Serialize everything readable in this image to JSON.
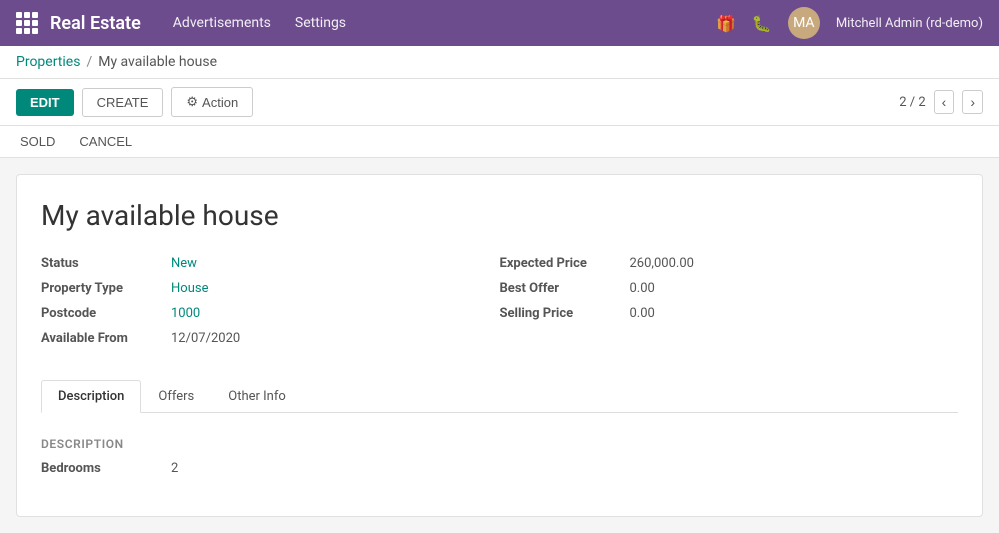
{
  "app": {
    "name": "Real Estate",
    "nav": [
      "Advertisements",
      "Settings"
    ],
    "user": "Mitchell Admin (rd-demo)"
  },
  "breadcrumb": {
    "parent": "Properties",
    "separator": "/",
    "current": "My available house"
  },
  "toolbar": {
    "edit_label": "EDIT",
    "create_label": "CREATE",
    "action_label": "Action",
    "action_icon": "⚙",
    "pagination": "2 / 2"
  },
  "status_buttons": {
    "sold": "SOLD",
    "cancel": "CANCEL"
  },
  "record": {
    "title": "My available house",
    "fields_left": [
      {
        "label": "Status",
        "value": "New",
        "type": "link"
      },
      {
        "label": "Property Type",
        "value": "House",
        "type": "link"
      },
      {
        "label": "Postcode",
        "value": "1000",
        "type": "link"
      },
      {
        "label": "Available From",
        "value": "12/07/2020",
        "type": "plain"
      }
    ],
    "fields_right": [
      {
        "label": "Expected Price",
        "value": "260,000.00",
        "type": "plain"
      },
      {
        "label": "Best Offer",
        "value": "0.00",
        "type": "plain"
      },
      {
        "label": "Selling Price",
        "value": "0.00",
        "type": "plain"
      }
    ]
  },
  "tabs": [
    {
      "id": "description",
      "label": "Description",
      "active": true
    },
    {
      "id": "offers",
      "label": "Offers",
      "active": false
    },
    {
      "id": "other-info",
      "label": "Other Info",
      "active": false
    }
  ],
  "tab_content": {
    "description": {
      "section_label": "Description",
      "fields": [
        {
          "label": "Bedrooms",
          "value": "2"
        }
      ]
    }
  }
}
